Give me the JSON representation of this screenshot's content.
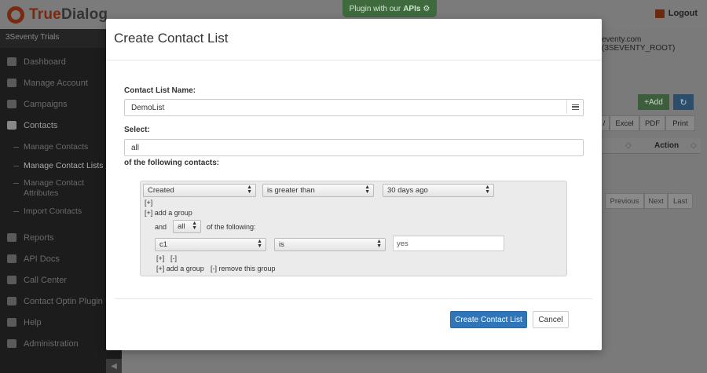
{
  "app": {
    "logo_part1": "True",
    "logo_part2": "Dialog",
    "plugin_label": "Plugin with our",
    "plugin_label_strong": "APIs",
    "logout": "Logout",
    "account_label": "3Seventy Trials",
    "account_right": "eventy.com (3SEVENTY_ROOT)"
  },
  "sidebar": {
    "items": [
      {
        "label": "Dashboard",
        "icon": "home-icon"
      },
      {
        "label": "Manage Account",
        "icon": "cloud-icon"
      },
      {
        "label": "Campaigns",
        "icon": "mobile-icon"
      },
      {
        "label": "Contacts",
        "icon": "book-icon"
      }
    ],
    "sub_items": [
      "Manage Contacts",
      "Manage Contact Lists",
      "Manage Contact Attributes",
      "Import Contacts"
    ],
    "items2": [
      {
        "label": "Reports",
        "icon": "bar-chart-icon"
      },
      {
        "label": "API Docs",
        "icon": "home-icon"
      },
      {
        "label": "Call Center",
        "icon": "chat-icon"
      },
      {
        "label": "Contact Optin Plugin",
        "icon": "code-icon"
      },
      {
        "label": "Help",
        "icon": "question-icon"
      },
      {
        "label": "Administration",
        "icon": "edit-icon"
      }
    ]
  },
  "background_table": {
    "add": "Add",
    "export": [
      "/",
      "Excel",
      "PDF",
      "Print"
    ],
    "col_action": "Action",
    "pager": [
      "Previous",
      "Next",
      "Last"
    ]
  },
  "modal": {
    "title": "Create Contact List",
    "name_label": "Contact List Name:",
    "name_value": "DemoList",
    "select_label": "Select:",
    "select_value": "all",
    "following_label": "of the following contacts:",
    "rule1": {
      "field": "Created",
      "operator": "is greater than",
      "value": "30 days ago"
    },
    "plus": "[+]",
    "add_group": "[+] add a group",
    "group": {
      "and": "and",
      "match": "all",
      "of_following": "of the following:",
      "field": "c1",
      "operator": "is",
      "value": "yes",
      "plus": "[+]",
      "minus": "[-]",
      "add_group": "[+] add a group",
      "remove_group": "[-] remove this group"
    },
    "create_button": "Create Contact List",
    "cancel_button": "Cancel"
  }
}
